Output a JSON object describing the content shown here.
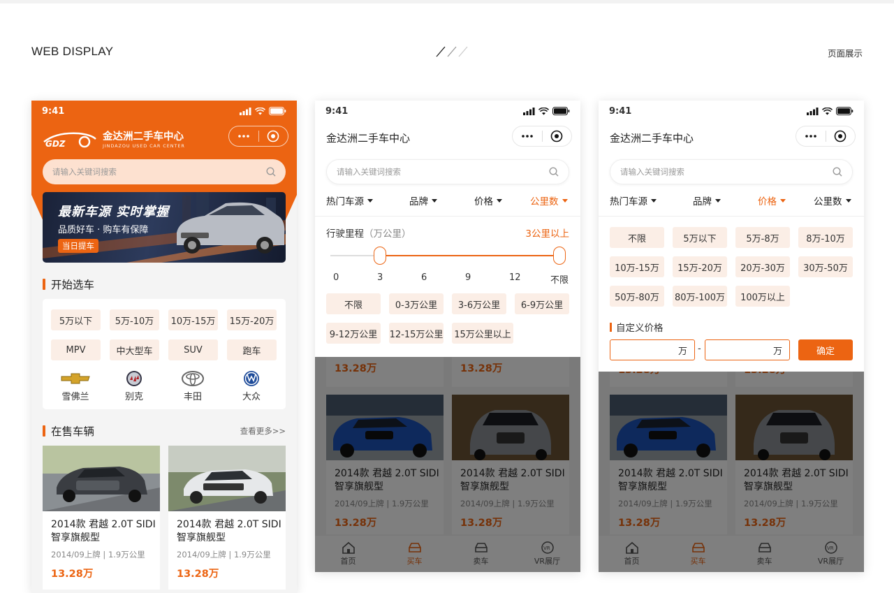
{
  "header": {
    "left": "WEB DISPLAY",
    "right": "页面展示"
  },
  "status": {
    "time": "9:41"
  },
  "app": {
    "title": "金达洲二手车中心",
    "logo_en": "JINDAZOU USED CAR CENTER",
    "logo_mark": "GDZ"
  },
  "search": {
    "placeholder": "请输入关键词搜索"
  },
  "banner": {
    "line1": "最新车源 实时掌握",
    "line2": "品质好车 · 购车有保障",
    "tag": "当日提车"
  },
  "start": {
    "title": "开始选车",
    "chips": [
      "5万以下",
      "5万-10万",
      "10万-15万",
      "15万-20万",
      "MPV",
      "中大型车",
      "SUV",
      "跑车"
    ],
    "brands": [
      "雪佛兰",
      "别克",
      "丰田",
      "大众"
    ]
  },
  "onsale": {
    "title": "在售车辆",
    "more": "查看更多>>"
  },
  "car": {
    "name": "2014款 君越 2.0T SIDI 智享旗舰型",
    "meta": "2014/09上牌  | 1.9万公里",
    "price": "13.28万"
  },
  "filters": [
    "热门车源",
    "品牌",
    "价格",
    "公里数"
  ],
  "mileage": {
    "label": "行驶里程",
    "unit": "（万公里）",
    "value": "3公里以上",
    "ticks": [
      "0",
      "3",
      "6",
      "9",
      "12",
      "不限"
    ],
    "range": [
      3,
      12
    ],
    "options": [
      "不限",
      "0-3万公里",
      "3-6万公里",
      "6-9万公里",
      "9-12万公里",
      "12-15万公里",
      "15万公里以上"
    ]
  },
  "price": {
    "options": [
      "不限",
      "5万以下",
      "5万-8万",
      "8万-10万",
      "10万-15万",
      "15万-20万",
      "20万-30万",
      "30万-50万",
      "50万-80万",
      "80万-100万",
      "100万以上"
    ],
    "custom_label": "自定义价格",
    "unit": "万",
    "dash": "-",
    "confirm": "确定"
  },
  "tabs": [
    "首页",
    "买车",
    "卖车",
    "VR展厅"
  ],
  "colors": {
    "accent": "#ec6412",
    "chip_bg": "#fbeee6"
  }
}
